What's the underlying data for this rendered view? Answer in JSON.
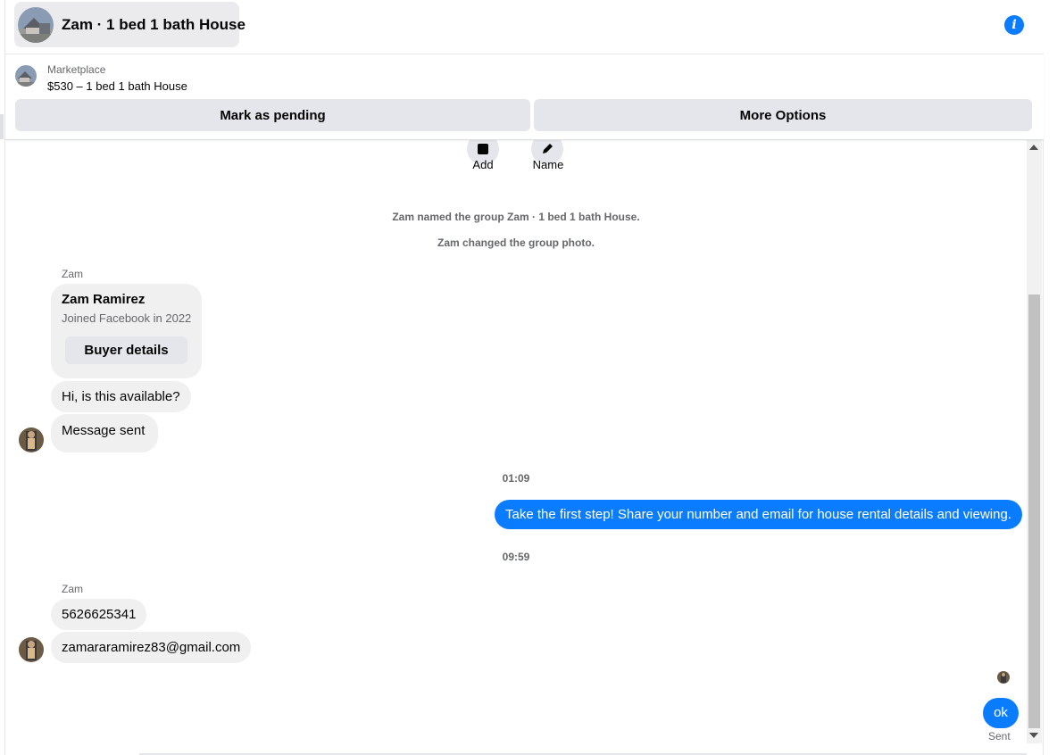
{
  "header": {
    "title": "Zam · 1 bed 1 bath House",
    "info_icon": "info-icon",
    "info_glyph": "i"
  },
  "marketplace": {
    "label": "Marketplace",
    "listing": "$530 – 1 bed 1 bath House",
    "mark_pending": "Mark as pending",
    "more_options": "More Options"
  },
  "actions": [
    {
      "label": "Add",
      "icon": "add-person-icon"
    },
    {
      "label": "Name",
      "icon": "pencil-icon"
    }
  ],
  "system_messages": [
    "Zam named the group Zam · 1 bed 1 bath House.",
    "Zam changed the group photo."
  ],
  "thread": {
    "sender_1": "Zam",
    "profile_card": {
      "name": "Zam Ramirez",
      "joined": "Joined Facebook in 2022",
      "button": "Buyer details"
    },
    "incoming_1": [
      "Hi, is this available?",
      "Message sent"
    ],
    "time_1": "01:09",
    "outgoing_1": "Take the first step! Share your number and email for house rental details and viewing.",
    "time_2": "09:59",
    "sender_2": "Zam",
    "incoming_2": [
      "5626625341",
      "zamararamirez83@gmail.com"
    ],
    "outgoing_2": "ok",
    "status": "Sent"
  },
  "colors": {
    "accent": "#0a7cff",
    "bubble_in": "#f0f0f0",
    "button_gray": "#e4e6eb",
    "muted_text": "#65676b"
  }
}
